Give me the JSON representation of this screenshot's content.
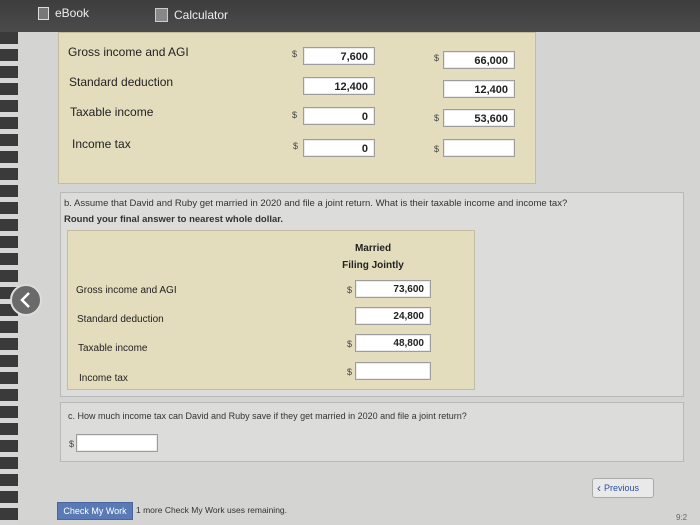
{
  "topbar": {
    "ebook_label": "eBook",
    "calculator_label": "Calculator"
  },
  "part_a": {
    "rows": [
      {
        "label": "Gross income and AGI",
        "col1": "7,600",
        "col2": "66,000",
        "col1_dollar": "$",
        "col2_dollar": "$"
      },
      {
        "label": "Standard deduction",
        "col1": "12,400",
        "col2": "12,400",
        "col1_dollar": "",
        "col2_dollar": ""
      },
      {
        "label": "Taxable income",
        "col1": "0",
        "col2": "53,600",
        "col1_dollar": "$",
        "col2_dollar": "$"
      },
      {
        "label": "Income tax",
        "col1": "0",
        "col2": "",
        "col1_dollar": "$",
        "col2_dollar": "$"
      }
    ]
  },
  "part_b": {
    "question_line1": "b. Assume that David and Ruby get married in 2020 and file a joint return. What is their taxable income and income tax?",
    "question_line2": "Round your final answer to nearest whole dollar.",
    "column_header_line1": "Married",
    "column_header_line2": "Filing Jointly",
    "rows": [
      {
        "label": "Gross income and AGI",
        "value": "73,600",
        "dollar": "$"
      },
      {
        "label": "Standard deduction",
        "value": "24,800",
        "dollar": ""
      },
      {
        "label": "Taxable income",
        "value": "48,800",
        "dollar": "$"
      },
      {
        "label": "Income tax",
        "value": "",
        "dollar": "$"
      }
    ]
  },
  "part_c": {
    "question": "c. How much income tax can David and Ruby save if they get married in 2020 and file a joint return?",
    "dollar": "$",
    "value": ""
  },
  "footer": {
    "check_button": "Check My Work",
    "note": "1 more Check My Work uses remaining.",
    "previous_button": "Previous",
    "clock": "9:2"
  },
  "icons": {
    "back": "chevron-left-icon",
    "ebook": "book-icon",
    "calculator": "calculator-icon",
    "previous": "chevron-left-icon"
  }
}
